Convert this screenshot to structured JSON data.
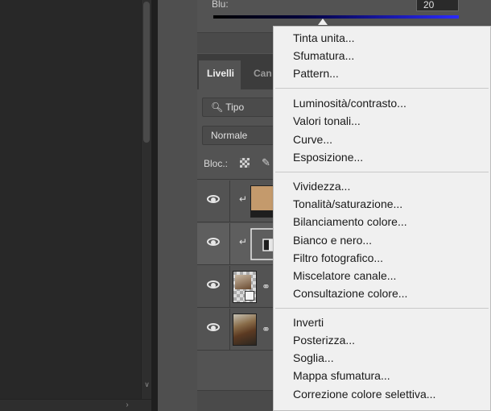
{
  "properties": {
    "blue_label": "Blu:",
    "blue_value": "20"
  },
  "layers_panel": {
    "tab_layers": "Livelli",
    "tab_channels": "Can",
    "filter_label": "Tipo",
    "blend_mode": "Normale",
    "lock_label": "Bloc.:"
  },
  "menu": {
    "group1": [
      "Tinta unita...",
      "Sfumatura...",
      "Pattern..."
    ],
    "group2": [
      "Luminosità/contrasto...",
      "Valori tonali...",
      "Curve...",
      "Esposizione..."
    ],
    "group3": [
      "Vividezza...",
      "Tonalità/saturazione...",
      "Bilanciamento colore...",
      "Bianco e nero...",
      "Filtro fotografico...",
      "Miscelatore canale...",
      "Consultazione colore..."
    ],
    "group4": [
      "Inverti",
      "Posterizza...",
      "Soglia...",
      "Mappa sfumatura...",
      "Correzione colore selettiva..."
    ]
  },
  "colors": {
    "swatch_fill": "#c49a6c",
    "menu_bg": "#f0f0f0",
    "panel_bg": "#535353"
  }
}
